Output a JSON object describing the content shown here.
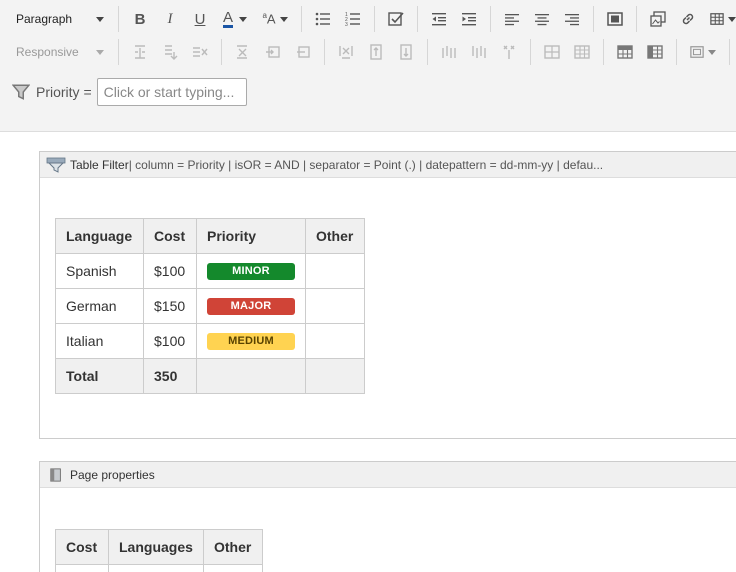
{
  "toolbar": {
    "paragraph_style": "Paragraph",
    "responsive_label": "Responsive",
    "filter_label": "Priority =",
    "filter_placeholder": "Click or start typing..."
  },
  "table_filter_macro": {
    "title": "Table Filter",
    "params": " | column = Priority | isOR = AND | separator = Point (.) | datepattern = dd-mm-yy | defau...",
    "headers": [
      "Language",
      "Cost",
      "Priority",
      "Other"
    ],
    "rows": [
      {
        "language": "Spanish",
        "cost": "$100",
        "priority": "MINOR",
        "priority_color": "#14892c",
        "priority_text_color": "#ffffff",
        "other": ""
      },
      {
        "language": "German",
        "cost": "$150",
        "priority": "MAJOR",
        "priority_color": "#d04437",
        "priority_text_color": "#ffffff",
        "other": ""
      },
      {
        "language": "Italian",
        "cost": "$100",
        "priority": "MEDIUM",
        "priority_color": "#ffd351",
        "priority_text_color": "#594300",
        "other": ""
      }
    ],
    "total_label": "Total",
    "total_value": "350"
  },
  "page_properties_macro": {
    "title": "Page properties",
    "headers": [
      "Cost",
      "Languages",
      "Other"
    ]
  },
  "colors": {
    "font_color_underline": "#1a55a5",
    "toolbar_bg": "#f3f3f3"
  }
}
